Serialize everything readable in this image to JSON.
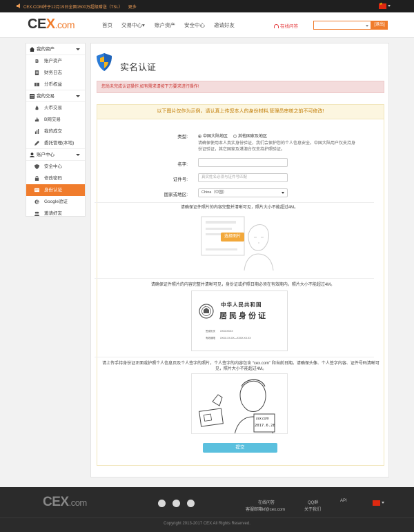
{
  "topbar": {
    "notice": "CEX.COM将于12月19日全面1500万超级赠送（TSL）",
    "more": "更多"
  },
  "header": {
    "logo_main": "CE",
    "logo_x": "X",
    "logo_dotcom": ".com",
    "nav": [
      "首页",
      "交易中心▾",
      "账户资产",
      "安全中心",
      "邀请好友"
    ],
    "support": "在线问答",
    "search_placeholder": "",
    "logout": "[退出]"
  },
  "sidebar": {
    "sections": [
      {
        "title": "我的资产",
        "icon": "home-icon",
        "items": [
          {
            "label": "账户资产",
            "icon": "bitcoin-icon"
          },
          {
            "label": "财务日志",
            "icon": "document-icon"
          },
          {
            "label": "分币权益",
            "icon": "book-icon"
          }
        ]
      },
      {
        "title": "我的交易",
        "icon": "list-icon",
        "items": [
          {
            "label": "火币交易",
            "icon": "flame-icon"
          },
          {
            "label": "B网交易",
            "icon": "thumb-icon"
          },
          {
            "label": "我的成交",
            "icon": "chart-icon"
          },
          {
            "label": "委托管理(本地)",
            "icon": "pencil-icon"
          }
        ]
      },
      {
        "title": "账户中心",
        "icon": "user-icon",
        "items": [
          {
            "label": "安全中心",
            "icon": "shield-icon"
          },
          {
            "label": "修改密码",
            "icon": "lock-icon"
          },
          {
            "label": "身份认证",
            "icon": "id-card-icon"
          },
          {
            "label": "Google验证",
            "icon": "google-icon"
          },
          {
            "label": "邀请好友",
            "icon": "users-icon"
          }
        ]
      }
    ]
  },
  "main": {
    "title": "实名认证",
    "warning": "您尚未完成认证操作,如有需求请按下方要求进行操作!",
    "note": "以下图片仅作为示例，请认真上传您本人的身份材料,管理员审核之前不可修改!",
    "type_label": "类型:",
    "type_options": [
      "中国大陆地区",
      "其他国家及地区"
    ],
    "type_desc": "请确保使用本人真实身份验证，我们会保护您的个人信息安全。中国大陆用户仅支持身份证验证，其它国家及港澳台仅支持护照验证。",
    "name_label": "名字:",
    "name_value": "",
    "id_label": "证件号:",
    "id_placeholder": "真实姓名必须与证件号匹配",
    "country_label": "国家或地区:",
    "country_value": "China（中国）",
    "hint1": "请确保证件照片的内容完整并清晰可见，照片大小不能超过4M。",
    "choose_button": "选择图片",
    "hint2": "请确保证件照片的内容完整并清晰可见，身份证或护照日期必须在有效期内，照片大小不能超过4M。",
    "idcard_title1": "中华人民共和国",
    "idcard_title2": "居民身份证",
    "idcard_authority_label": "签发机关",
    "idcard_authority_value": "XXXXXXXX",
    "idcard_validity_label": "有效期限",
    "idcard_validity_value": "XXXX.XX.XX—XXXX.XX.XX",
    "hint3": "请上传手持身份证正面或护照个人信息页及个人签字的照片，个人签字的内容包含 “cex.com” 和当前日期。请确保头像、个人签字内容、证件号码清晰可见，照片大小不能超过4M。",
    "sign_text": "cex.com",
    "sign_date": "2017.6.28",
    "submit": "提交"
  },
  "footer": {
    "logo_main": "CEX",
    "logo_dotcom": ".com",
    "links": [
      {
        "label": "在线问答"
      },
      {
        "label": "QQ群"
      },
      {
        "label": "API"
      },
      {
        "label": "客服邮箱kf@cex.com"
      },
      {
        "label": "关于我们"
      }
    ],
    "copyright": "Copyright 2013-2017 CEX All Rights Reserved."
  },
  "colors": {
    "accent": "#f07c2c",
    "warn_bg": "#f4dcdc",
    "note_bg": "#fcf6e0",
    "submit": "#5bc0de",
    "footer_bg": "#2b2b2b"
  }
}
